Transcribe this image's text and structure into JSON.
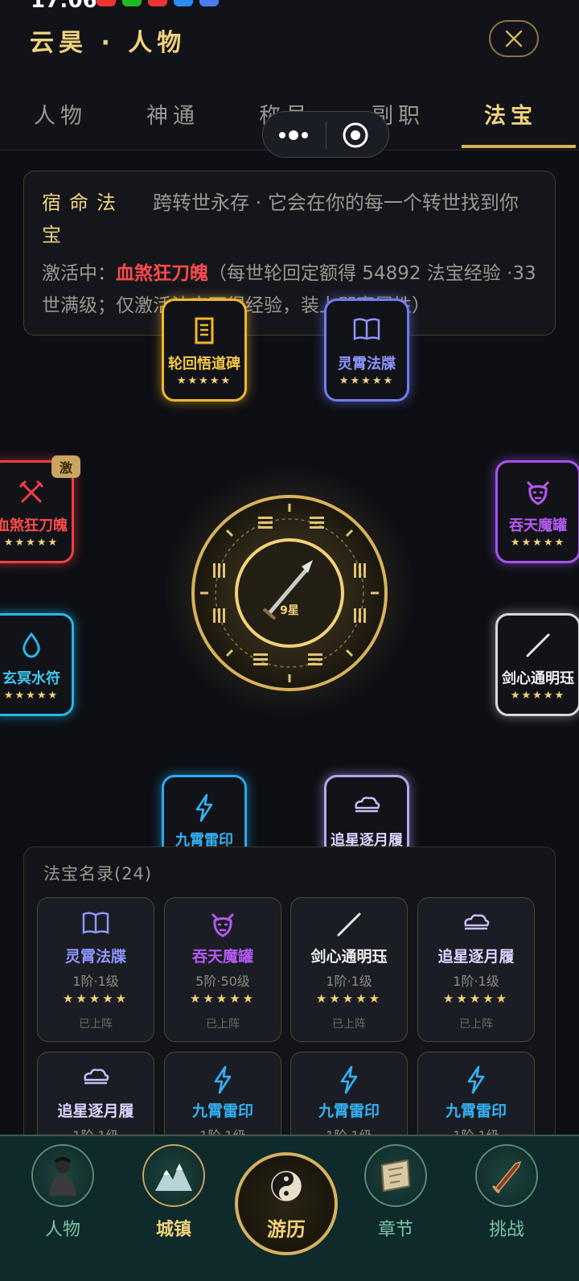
{
  "status": {
    "time": "17:06"
  },
  "header": {
    "title": "云昊 · 人物"
  },
  "tabs": [
    "人物",
    "神通",
    "称号",
    "副职",
    "法宝"
  ],
  "active_tab": "法宝",
  "info": {
    "label": "宿命法宝",
    "desc": "跨转世永存 · 它会在你的每一个转世找到你",
    "active_prefix": "激活中：",
    "active_name": "血煞狂刀魄",
    "active_detail": "（每世轮回定额得 54892 法宝经验 ·33 世满级；仅激活法宝可得经验，装上即享属性）"
  },
  "orb": {
    "star_label": "9星"
  },
  "ring": [
    {
      "name": "轮回悟道碑",
      "stars": "★★★★★",
      "color": "#f0b62d",
      "icon": "stele-icon"
    },
    {
      "name": "灵霄法牒",
      "stars": "★★★★★",
      "color": "#6f7cf0",
      "icon": "book-icon"
    },
    {
      "name": "血煞狂刀魄",
      "stars": "★★★★★",
      "color": "#ef3e45",
      "icon": "crossed-swords-icon",
      "badge": "激"
    },
    {
      "name": "吞天魔罐",
      "stars": "★★★★★",
      "color": "#a553ef",
      "icon": "demon-mask-icon"
    },
    {
      "name": "玄冥水符",
      "stars": "★★★★★",
      "color": "#27b8e8",
      "icon": "water-drop-icon"
    },
    {
      "name": "剑心通明珏",
      "stars": "★★★★★",
      "color": "#d8d8dc",
      "icon": "sword-line-icon"
    },
    {
      "name": "九霄雷印",
      "stars": "★★★★★",
      "color": "#2aa9f0",
      "icon": "lightning-icon"
    },
    {
      "name": "追星逐月履",
      "stars": "★★★★★",
      "color": "#b6a6f0",
      "icon": "cloud-icon"
    }
  ],
  "catalog": {
    "title": "法宝名录(24)",
    "items": [
      {
        "name": "灵霄法牒",
        "level": "1阶·1级",
        "stars": "★★★★★",
        "status": "已上阵",
        "color": "#8f96ff",
        "icon": "book-icon"
      },
      {
        "name": "吞天魔罐",
        "level": "5阶·50级",
        "stars": "★★★★★",
        "status": "已上阵",
        "color": "#b45af0",
        "icon": "demon-mask-icon"
      },
      {
        "name": "剑心通明珏",
        "level": "1阶·1级",
        "stars": "★★★★★",
        "status": "已上阵",
        "color": "#e6e6ea",
        "icon": "sword-line-icon"
      },
      {
        "name": "追星逐月履",
        "level": "1阶·1级",
        "stars": "★★★★★",
        "status": "已上阵",
        "color": "#c9bdf6",
        "icon": "cloud-icon"
      },
      {
        "name": "追星逐月履",
        "level": "1阶·1级",
        "stars": "",
        "status": "",
        "color": "#c9bdf6",
        "icon": "cloud-icon"
      },
      {
        "name": "九霄雷印",
        "level": "1阶·1级",
        "stars": "",
        "status": "",
        "color": "#34b2f4",
        "icon": "lightning-icon"
      },
      {
        "name": "九霄雷印",
        "level": "1阶·1级",
        "stars": "",
        "status": "",
        "color": "#34b2f4",
        "icon": "lightning-icon"
      },
      {
        "name": "九霄雷印",
        "level": "1阶·1级",
        "stars": "",
        "status": "",
        "color": "#34b2f4",
        "icon": "lightning-icon"
      }
    ]
  },
  "nav": [
    "人物",
    "城镇",
    "游历",
    "章节",
    "挑战"
  ]
}
